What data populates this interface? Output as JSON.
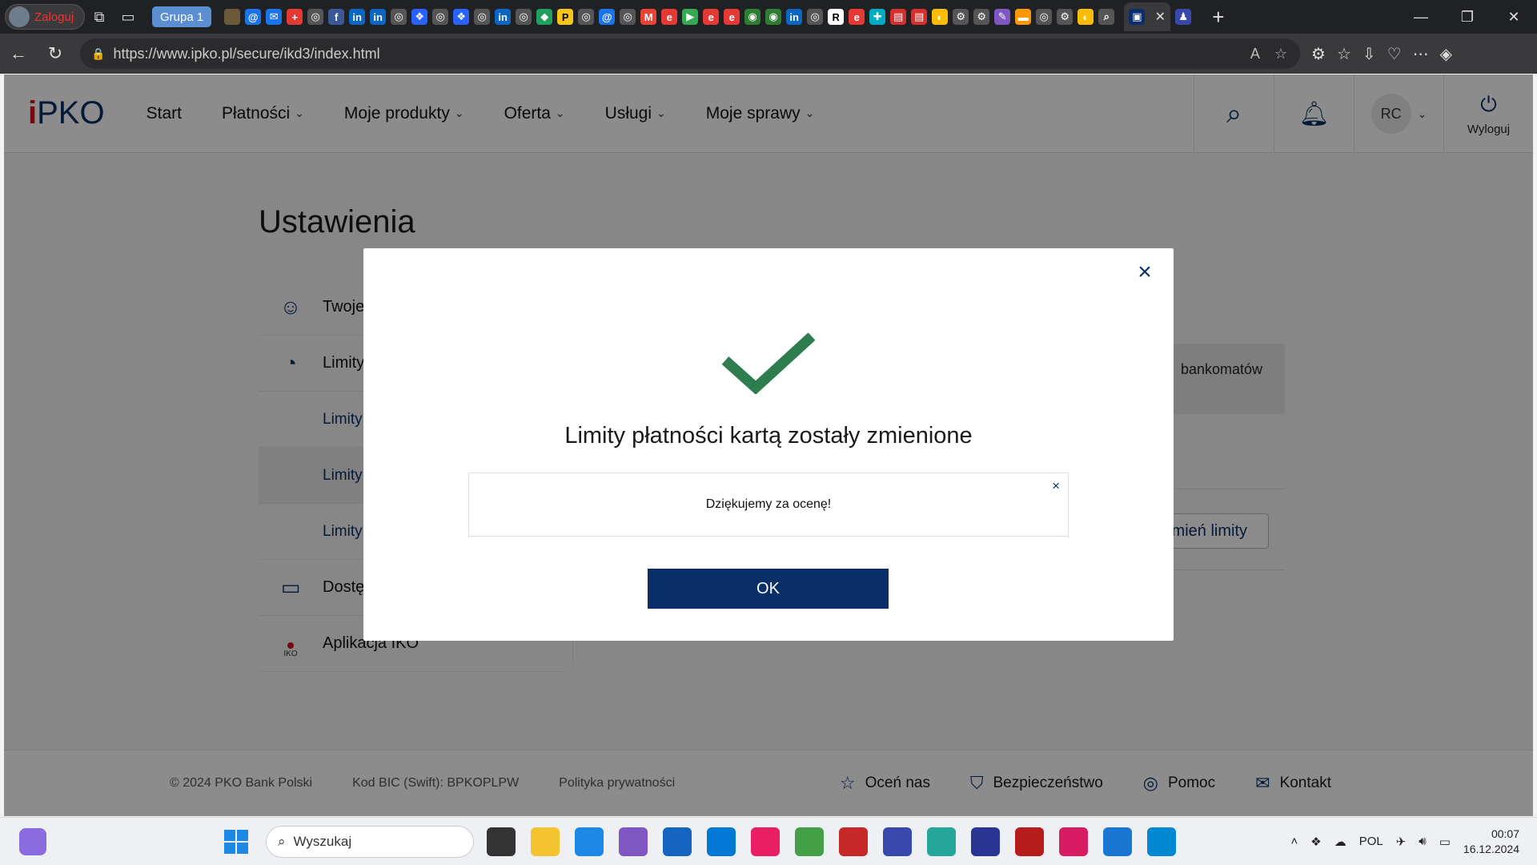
{
  "browser": {
    "profile_label": "Zaloguj",
    "tab_group_label": "Grupa 1",
    "url": "https://www.ipko.pl/secure/ikd3/index.html",
    "new_tab": "+",
    "tab_close": "✕"
  },
  "site": {
    "logo_i": "i",
    "logo_text": "PKO",
    "menu": [
      {
        "label": "Start"
      },
      {
        "label": "Płatności"
      },
      {
        "label": "Moje produkty"
      },
      {
        "label": "Oferta"
      },
      {
        "label": "Usługi"
      },
      {
        "label": "Moje sprawy"
      }
    ],
    "user_initials": "RC",
    "logout_label": "Wyloguj"
  },
  "settings": {
    "title": "Ustawienia",
    "side_items": [
      {
        "label": "Twoje"
      },
      {
        "label": "Limity"
      },
      {
        "label": "Limity"
      },
      {
        "label": "Limity"
      },
      {
        "label": "Limity"
      },
      {
        "label": "Dostę"
      },
      {
        "label": "Aplikacja IKO"
      }
    ],
    "iko_icon_text": "IKO",
    "bg_card_text": "bankomatów",
    "bg_button_label": "mień limity"
  },
  "modal": {
    "title": "Limity płatności kartą zostały zmienione",
    "rating_text": "Dziękujemy za ocenę!",
    "ok_label": "OK",
    "close_symbol": "×",
    "rating_close_symbol": "×",
    "check_color": "#2e7d4f"
  },
  "footer": {
    "copyright": "© 2024 PKO Bank Polski",
    "bic": "Kod BIC (Swift): BPKOPLPW",
    "privacy": "Polityka prywatności",
    "links": [
      {
        "label": "Oceń nas",
        "icon": "star-icon"
      },
      {
        "label": "Bezpieczeństwo",
        "icon": "shield-icon"
      },
      {
        "label": "Pomoc",
        "icon": "lifebuoy-icon"
      },
      {
        "label": "Kontakt",
        "icon": "envelope-icon"
      }
    ]
  },
  "taskbar": {
    "search_placeholder": "Wyszukaj",
    "language": "POL",
    "time": "00:07",
    "date": "16.12.2024"
  },
  "colors": {
    "brand_navy": "#0a2f68",
    "brand_red": "#d3111d",
    "success_green": "#2e7d4f"
  }
}
